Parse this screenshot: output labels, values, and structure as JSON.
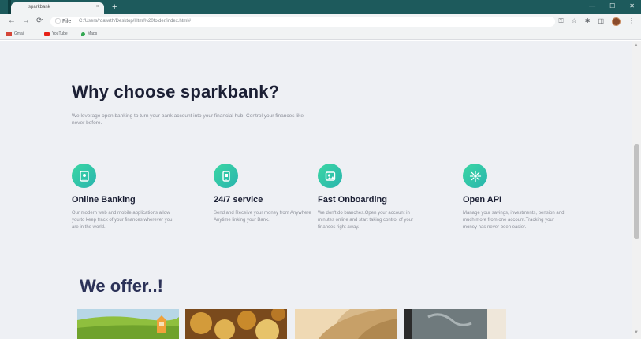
{
  "browser": {
    "tab_title": "sparkbank",
    "tab_close": "×",
    "new_tab": "+",
    "window_controls": [
      "—",
      "☐",
      "✕"
    ],
    "nav_back": "←",
    "nav_forward": "→",
    "nav_reload": "⟳",
    "url_info": "ⓘ File",
    "url": "C:/Users/rdawrth/Desktop/Html%20folder/index.html#",
    "toolbar_icons": [
      "⚿",
      "☆",
      "✱",
      "◫",
      "⋮"
    ],
    "bookmarks": [
      {
        "label": "Gmail",
        "icon": "gmail-icon",
        "color": "#d44638"
      },
      {
        "label": "YouTube",
        "icon": "youtube-icon",
        "color": "#e62117"
      },
      {
        "label": "Maps",
        "icon": "maps-icon",
        "color": "#34a853"
      }
    ]
  },
  "page": {
    "headline": "Why choose sparkbank?",
    "intro": "We leverage open banking to turn your bank account into your financial hub. Control your finances like never before.",
    "features": [
      {
        "icon": "online-banking-icon",
        "title": "Online Banking",
        "description": "Our modern web and mobile applications allow you to keep track of your finances wherever you are in the world."
      },
      {
        "icon": "service-24-7-icon",
        "title": "24/7 service",
        "description": "Send and Receive your money from Anywhere Anytime linking your Bank."
      },
      {
        "icon": "fast-onboarding-icon",
        "title": "Fast Onboarding",
        "description": "We don't do branches.Open your account in minutes online and start taking control of your finances right away."
      },
      {
        "icon": "open-api-icon",
        "title": "Open API",
        "description": "Manage your savings, investments, pension and much more from one account.Tracking your money has never been easier."
      }
    ],
    "offer_title": "We offer..!",
    "accent_gradient": [
      "#3bd7a3",
      "#29b4ae"
    ],
    "heading_color": "#1b1f34",
    "offer_color": "#2c3258"
  }
}
